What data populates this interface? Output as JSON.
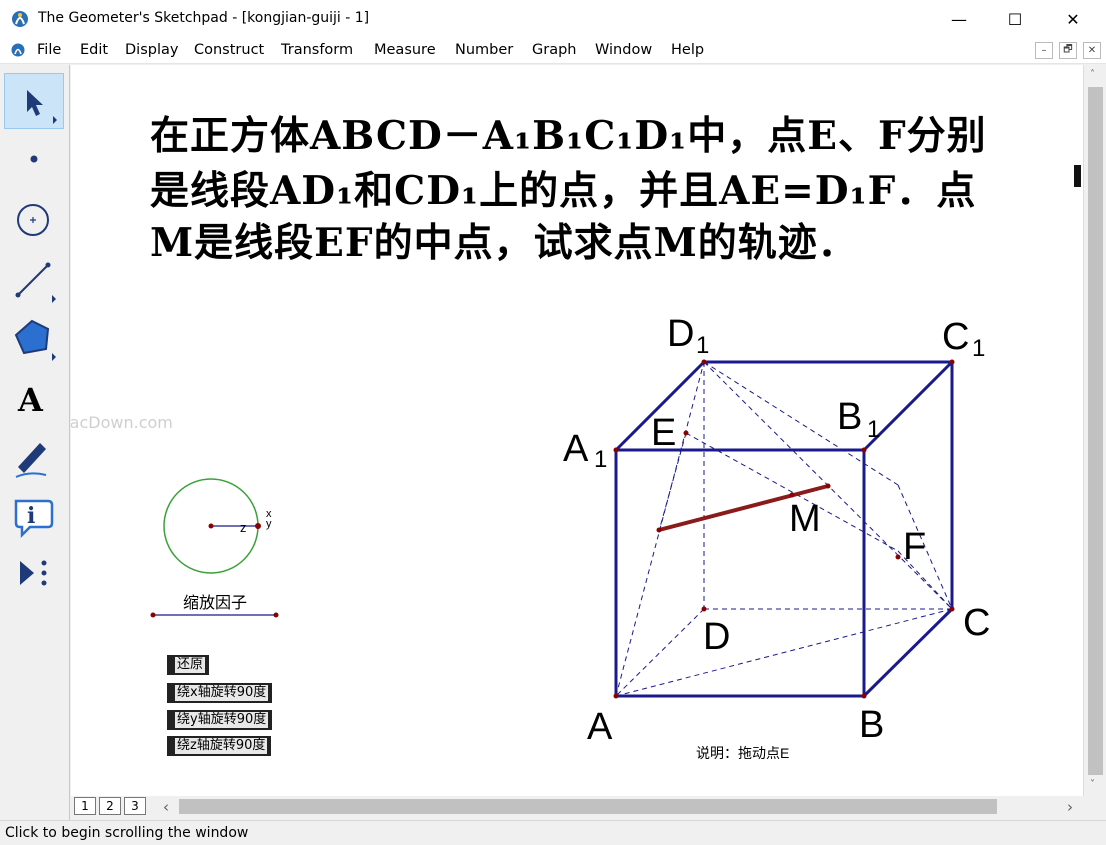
{
  "window": {
    "title": "The Geometer's Sketchpad - [kongjian-guiji - 1]",
    "minimize": "—",
    "maximize": "☐",
    "close": "✕"
  },
  "menu": {
    "items": [
      "File",
      "Edit",
      "Display",
      "Construct",
      "Transform",
      "Measure",
      "Number",
      "Graph",
      "Window",
      "Help"
    ],
    "mdi": [
      "–",
      "🗗",
      "✕"
    ]
  },
  "toolbox": {
    "tools": [
      "arrow-select",
      "point",
      "compass",
      "straightedge",
      "polygon",
      "text",
      "marker",
      "information",
      "custom-tools"
    ],
    "text_tool_glyph": "A"
  },
  "problem": {
    "lines": [
      "在正方体ABCD－A₁B₁C₁D₁中，点E、F分别",
      "是线段AD₁和CD₁上的点，并且AE=D₁F．点",
      "M是线段EF的中点，试求点M的轨迹．"
    ]
  },
  "rotation_widget": {
    "axis_labels": [
      "x",
      "y",
      "z"
    ],
    "scale_label": "缩放因子"
  },
  "buttons": {
    "reset": "还原",
    "rot_x": "绕x轴旋转90度",
    "rot_y": "绕y轴旋转90度",
    "rot_z": "绕z轴旋转90度"
  },
  "cube": {
    "labels": {
      "A": "A",
      "B": "B",
      "C": "C",
      "D": "D",
      "A1": "A",
      "B1": "B",
      "C1": "C",
      "D1": "D",
      "sub": "1",
      "E": "E",
      "F": "F",
      "M": "M"
    },
    "caption": "说明：拖动点E",
    "colors": {
      "edge": "#1a1a8c",
      "segment": "#8b1a1a",
      "point": "#8b0000",
      "circle": "#3aa13a"
    }
  },
  "watermark": "www.MacDown.com",
  "pages": [
    "1",
    "2",
    "3"
  ],
  "scroll": {
    "left": "‹",
    "right": "›",
    "up": "˄",
    "down": "˅"
  },
  "status": "Click to begin scrolling the window"
}
